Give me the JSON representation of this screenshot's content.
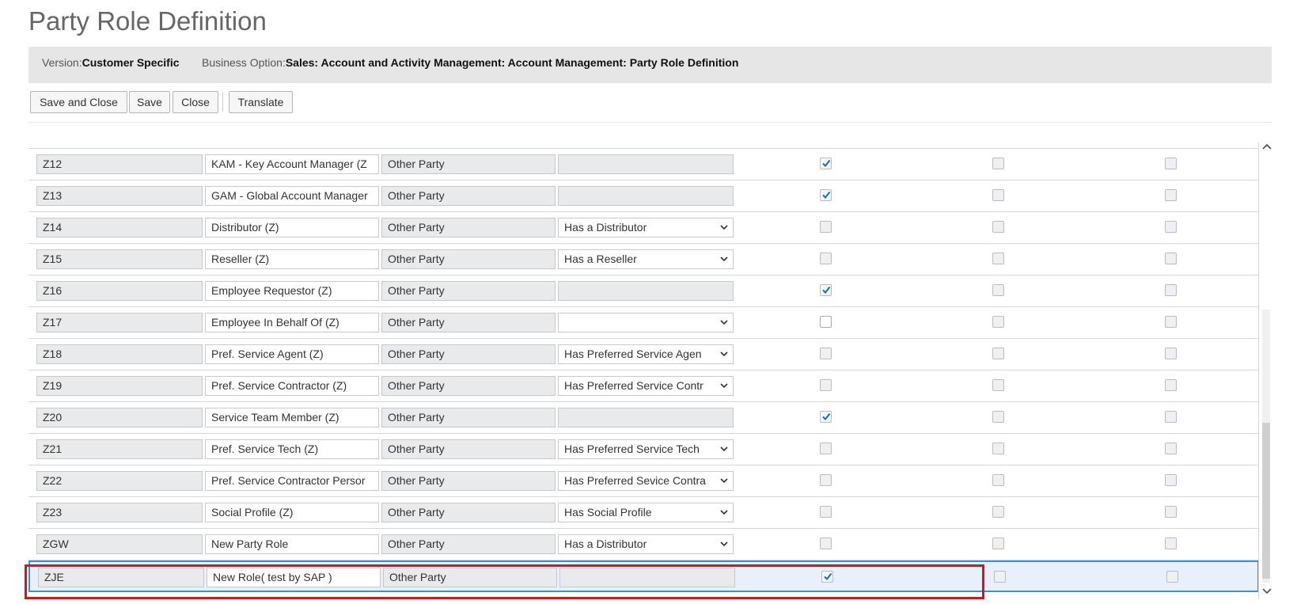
{
  "page": {
    "title": "Party Role Definition"
  },
  "info": {
    "version_label": "Version:",
    "version_value": "Customer Specific",
    "business_option_label": "Business Option:",
    "business_option_value": "Sales: Account and Activity Management: Account Management: Party Role Definition"
  },
  "toolbar": {
    "save_and_close": "Save and Close",
    "save": "Save",
    "close": "Close",
    "translate": "Translate"
  },
  "table": {
    "rows": [
      {
        "code": "",
        "description": "",
        "category": "",
        "relationship": "",
        "relationship_dropdown": false,
        "check1": false,
        "check1_editable": false,
        "check2": false,
        "check3": false,
        "selected": false
      },
      {
        "code": "Z12",
        "description": "KAM - Key Account Manager (Z",
        "category": "Other Party",
        "relationship": "",
        "relationship_dropdown": false,
        "check1": true,
        "check1_editable": false,
        "check2": false,
        "check3": false,
        "selected": false
      },
      {
        "code": "Z13",
        "description": "GAM - Global Account Manager",
        "category": "Other Party",
        "relationship": "",
        "relationship_dropdown": false,
        "check1": true,
        "check1_editable": false,
        "check2": false,
        "check3": false,
        "selected": false
      },
      {
        "code": "Z14",
        "description": "Distributor (Z)",
        "category": "Other Party",
        "relationship": "Has a Distributor",
        "relationship_dropdown": true,
        "check1": false,
        "check1_editable": false,
        "check2": false,
        "check3": false,
        "selected": false
      },
      {
        "code": "Z15",
        "description": "Reseller (Z)",
        "category": "Other Party",
        "relationship": "Has a Reseller",
        "relationship_dropdown": true,
        "check1": false,
        "check1_editable": false,
        "check2": false,
        "check3": false,
        "selected": false
      },
      {
        "code": "Z16",
        "description": "Employee Requestor (Z)",
        "category": "Other Party",
        "relationship": "",
        "relationship_dropdown": false,
        "check1": true,
        "check1_editable": false,
        "check2": false,
        "check3": false,
        "selected": false
      },
      {
        "code": "Z17",
        "description": "Employee In Behalf Of (Z)",
        "category": "Other Party",
        "relationship": "",
        "relationship_dropdown": true,
        "check1": false,
        "check1_editable": true,
        "check2": false,
        "check3": false,
        "selected": false
      },
      {
        "code": "Z18",
        "description": "Pref. Service Agent (Z)",
        "category": "Other Party",
        "relationship": "Has Preferred Service Agen",
        "relationship_dropdown": true,
        "check1": false,
        "check1_editable": false,
        "check2": false,
        "check3": false,
        "selected": false
      },
      {
        "code": "Z19",
        "description": "Pref. Service Contractor (Z)",
        "category": "Other Party",
        "relationship": "Has Preferred Service Contr",
        "relationship_dropdown": true,
        "check1": false,
        "check1_editable": false,
        "check2": false,
        "check3": false,
        "selected": false
      },
      {
        "code": "Z20",
        "description": "Service Team Member (Z)",
        "category": "Other Party",
        "relationship": "",
        "relationship_dropdown": false,
        "check1": true,
        "check1_editable": false,
        "check2": false,
        "check3": false,
        "selected": false
      },
      {
        "code": "Z21",
        "description": "Pref. Service Tech (Z)",
        "category": "Other Party",
        "relationship": "Has Preferred Service Tech",
        "relationship_dropdown": true,
        "check1": false,
        "check1_editable": false,
        "check2": false,
        "check3": false,
        "selected": false
      },
      {
        "code": "Z22",
        "description": "Pref. Service Contractor Persor",
        "category": "Other Party",
        "relationship": "Has Preferred Sevice Contra",
        "relationship_dropdown": true,
        "check1": false,
        "check1_editable": false,
        "check2": false,
        "check3": false,
        "selected": false
      },
      {
        "code": "Z23",
        "description": "Social Profile (Z)",
        "category": "Other Party",
        "relationship": "Has Social Profile",
        "relationship_dropdown": true,
        "check1": false,
        "check1_editable": false,
        "check2": false,
        "check3": false,
        "selected": false
      },
      {
        "code": "ZGW",
        "description": "New Party Role",
        "category": "Other Party",
        "relationship": "Has a Distributor",
        "relationship_dropdown": true,
        "check1": false,
        "check1_editable": false,
        "check2": false,
        "check3": false,
        "selected": false
      },
      {
        "code": "ZJE",
        "description": "New Role( test by SAP )",
        "category": "Other Party",
        "relationship": "",
        "relationship_dropdown": false,
        "check1": true,
        "check1_editable": false,
        "check2": false,
        "check3": false,
        "selected": true
      }
    ]
  },
  "colors": {
    "highlight": "#cc1a1a",
    "selection_border": "#3d8fd9",
    "checkmark": "#1b6fb8"
  },
  "icons": {
    "dropdown": "chevron-down-icon",
    "check": "checkmark-icon",
    "scroll_up": "chevron-up-icon",
    "scroll_down": "chevron-down-icon"
  }
}
